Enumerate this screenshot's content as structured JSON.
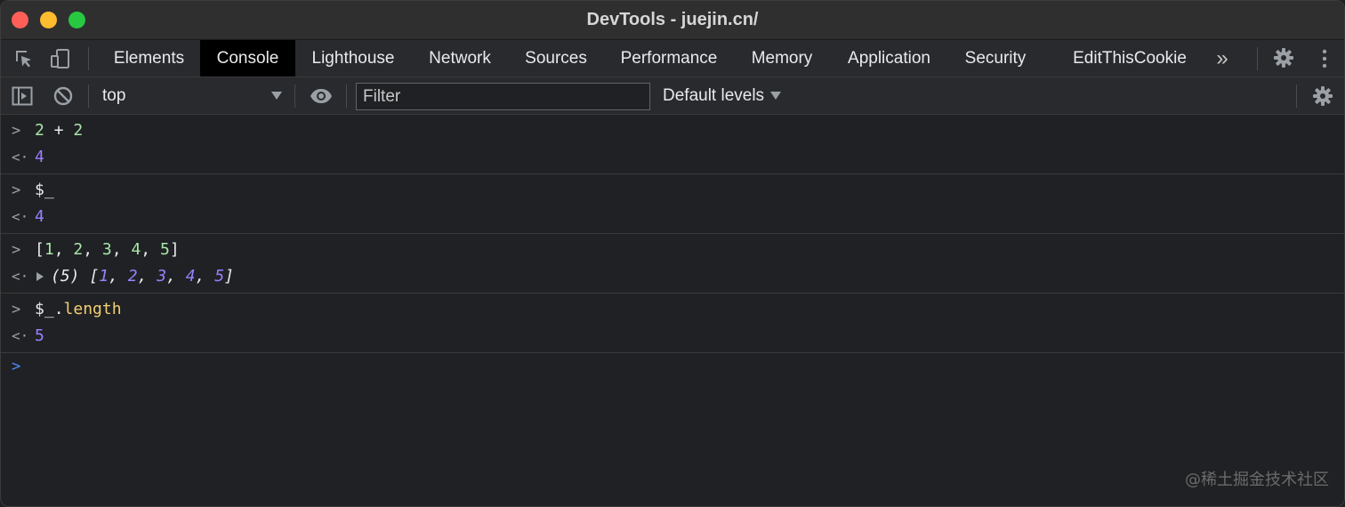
{
  "window": {
    "title": "DevTools - juejin.cn/"
  },
  "tabs": [
    {
      "label": "Elements",
      "active": false
    },
    {
      "label": "Console",
      "active": true
    },
    {
      "label": "Lighthouse",
      "active": false
    },
    {
      "label": "Network",
      "active": false
    },
    {
      "label": "Sources",
      "active": false
    },
    {
      "label": "Performance",
      "active": false
    },
    {
      "label": "Memory",
      "active": false
    },
    {
      "label": "Application",
      "active": false
    },
    {
      "label": "Security",
      "active": false
    },
    {
      "label": "EditThisCookie",
      "active": false
    }
  ],
  "tabbar": {
    "more_label": "»"
  },
  "toolbar": {
    "context": "top",
    "filter_placeholder": "Filter",
    "filter_value": "",
    "levels_label": "Default levels"
  },
  "console": {
    "entries": [
      {
        "input": {
          "left": "2",
          "op": " + ",
          "right": "2"
        },
        "result": "4"
      },
      {
        "input": {
          "text": "$_"
        },
        "result": "4"
      },
      {
        "input": {
          "open": "[",
          "items": [
            "1",
            "2",
            "3",
            "4",
            "5"
          ],
          "close": "]"
        },
        "result": {
          "count": "(5)",
          "open": "[",
          "items": [
            "1",
            "2",
            "3",
            "4",
            "5"
          ],
          "close": "]"
        }
      },
      {
        "input": {
          "obj": "$_",
          "dot": ".",
          "prop": "length"
        },
        "result": "5"
      }
    ]
  },
  "watermark": "@稀土掘金技术社区",
  "colors": {
    "background": "#202124",
    "number": "#9980ff",
    "property": "#f2ce74",
    "prompt": "#4e8bf7"
  }
}
